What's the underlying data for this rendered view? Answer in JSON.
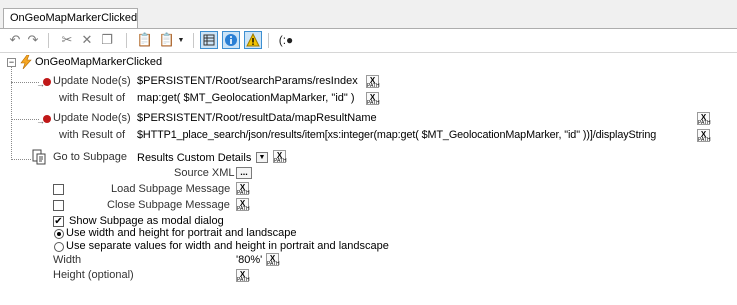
{
  "tabs": [
    {
      "label": "OnGeoMapMarkerClicked"
    }
  ],
  "toolbar": {
    "undo_icon": "undo-icon",
    "redo_icon": "redo-icon",
    "cut_icon": "cut-icon",
    "delete_icon": "delete-icon",
    "copy_icon": "copy-icon",
    "paste_icon": "paste-icon",
    "paste_menu_icon": "paste-menu-icon",
    "grid_icon": "grid-icon",
    "info_icon": "info-icon",
    "warning_icon": "warning-icon",
    "xpath_tool_icon": "xpath-tool-icon"
  },
  "tree": {
    "root_label": "OnGeoMapMarkerClicked",
    "xpath_button_text": [
      "X",
      "PATH"
    ],
    "action1": {
      "title": "Update Node(s)",
      "target": "$PERSISTENT/Root/searchParams/resIndex",
      "result_label": "with Result of",
      "result": "map:get( $MT_GeolocationMapMarker, \"id\" )"
    },
    "action2": {
      "title": "Update Node(s)",
      "target": "$PERSISTENT/Root/resultData/mapResultName",
      "result_label": "with Result of",
      "result": "$HTTP1_place_search/json/results/item[xs:integer(map:get( $MT_GeolocationMapMarker, \"id\" ))]/displayString"
    },
    "action3": {
      "title": "Go to Subpage",
      "subpage": "Results Custom Details",
      "source_xml_label": "Source XML",
      "source_xml_button": "...",
      "load_msg_label": "Load Subpage Message",
      "close_msg_label": "Close Subpage Message",
      "modal_label": "Show Subpage as modal dialog",
      "modal_checked": true,
      "load_msg_checked": false,
      "close_msg_checked": false,
      "radio_same": "Use width and height for portrait and landscape",
      "radio_separate": "Use separate values for width and height in portrait and landscape",
      "selected_radio": "same",
      "width_label": "Width",
      "width_value": "'80%'",
      "height_label": "Height (optional)"
    }
  },
  "colors": {
    "accent": "#3d8fd1",
    "dot": "#c01818",
    "lightning": "#f5a623"
  }
}
